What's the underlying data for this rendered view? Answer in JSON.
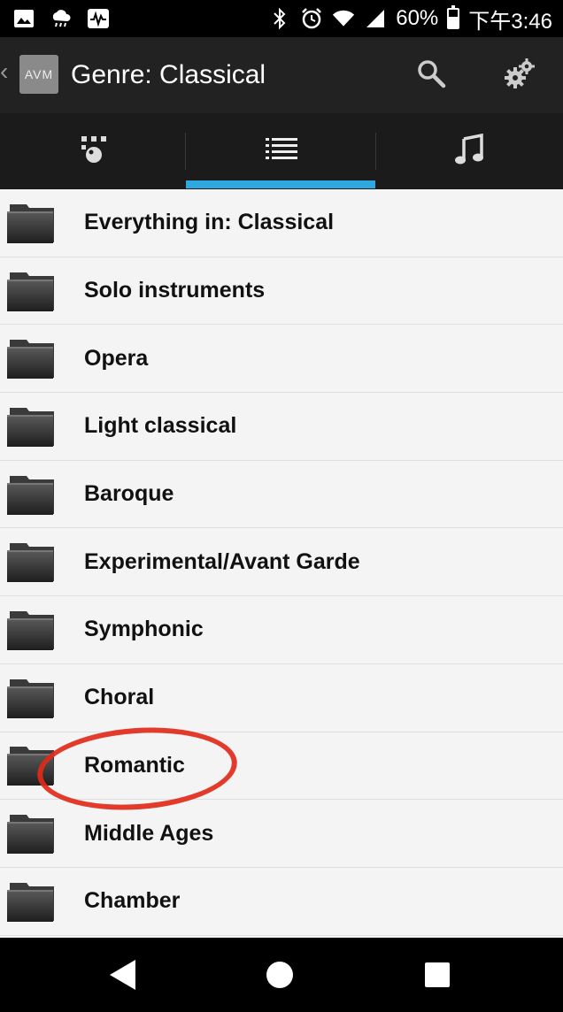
{
  "status_bar": {
    "battery_percent": "60%",
    "battery_level": 0.6,
    "time": "下午3:46",
    "icons": [
      "image-icon",
      "weather-icon",
      "activity-icon",
      "bluetooth-icon",
      "alarm-icon",
      "wifi-icon",
      "signal-icon",
      "battery-icon"
    ]
  },
  "action_bar": {
    "logo_text": "AVM",
    "title": "Genre: Classical",
    "back_icon": "chevron-left-icon",
    "search_icon": "search-icon",
    "settings_icon": "gear-icon"
  },
  "tabs": {
    "selected_index": 1,
    "icons": [
      "connections-icon",
      "list-icon",
      "music-note-icon"
    ],
    "indicator_color": "#2fa8e0"
  },
  "list": {
    "items": [
      {
        "label": "Everything in: Classical"
      },
      {
        "label": "Solo instruments"
      },
      {
        "label": "Opera"
      },
      {
        "label": "Light classical"
      },
      {
        "label": "Baroque"
      },
      {
        "label": "Experimental/Avant Garde"
      },
      {
        "label": "Symphonic"
      },
      {
        "label": "Choral"
      },
      {
        "label": "Romantic"
      },
      {
        "label": "Middle Ages"
      },
      {
        "label": "Chamber"
      }
    ],
    "highlighted_item": "Romantic",
    "highlight_color": "#e02a1a"
  },
  "nav_bar": {
    "icons": [
      "back-triangle-icon",
      "home-circle-icon",
      "recents-square-icon"
    ]
  }
}
